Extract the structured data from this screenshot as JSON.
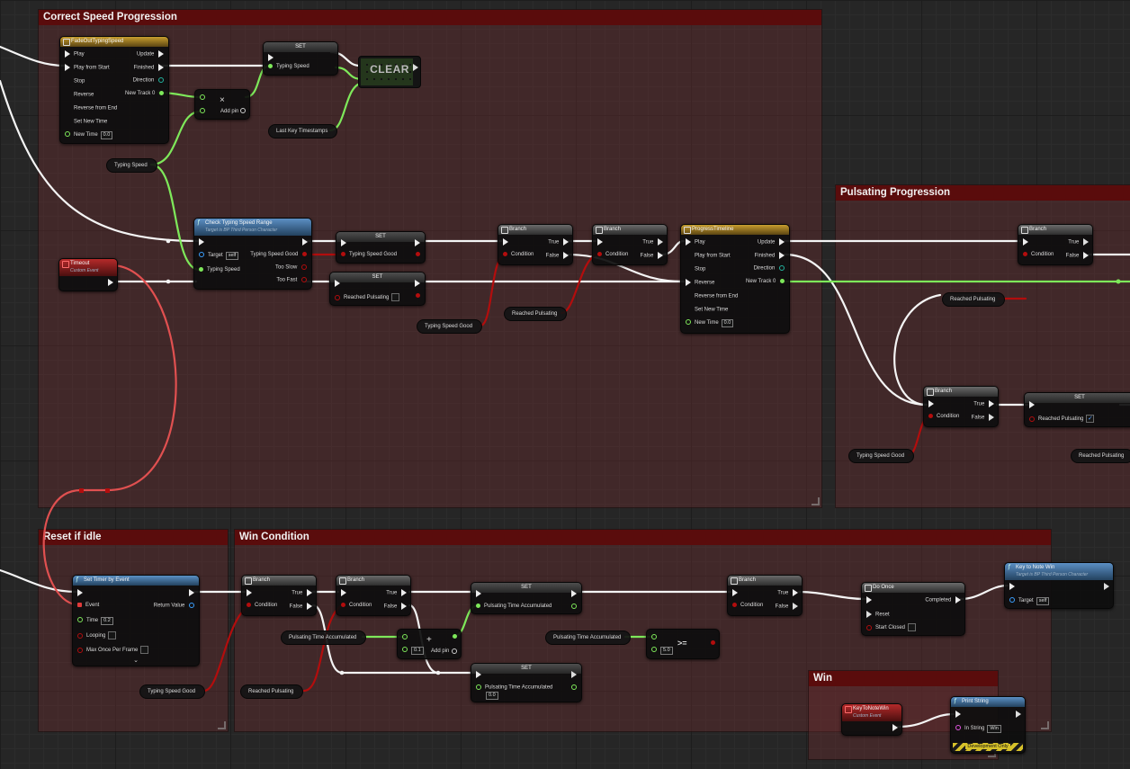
{
  "colors": {
    "comment_header": "#5a0c0c",
    "exec_wire": "#ffffff",
    "bool_wire": "#b30d0d",
    "float_wire": "#7ee85a",
    "event_wire": "#e05050"
  },
  "comments": {
    "correct_speed": "Correct Speed Progression",
    "pulsating": "Pulsating Progression",
    "reset_idle": "Reset if idle",
    "win_condition": "Win Condition",
    "win": "Win"
  },
  "timeline_fade": {
    "title": "FadeOutTypingSpeed",
    "in": [
      "Play",
      "Play from Start",
      "Stop",
      "Reverse",
      "Reverse from End",
      "Set New Time"
    ],
    "new_time_label": "New Time",
    "new_time_value": "0.0",
    "out": [
      "Update",
      "Finished",
      "Direction",
      "New Track 0"
    ]
  },
  "set_typing": {
    "title": "SET",
    "pin": "Typing Speed"
  },
  "clear": {
    "label": "CLEAR",
    "icon": "grid-array-icon"
  },
  "multiply": {
    "symbol": "×",
    "addpin": "Add pin"
  },
  "last_key": {
    "label": "Last Key Timestamps"
  },
  "typing_speed_var": {
    "label": "Typing Speed"
  },
  "timeout_event": {
    "title": "Timeout",
    "subtitle": "Custom Event"
  },
  "check_range": {
    "title": "Check Typing Speed Range",
    "subtitle": "Target is BP Third Person Character",
    "target": "Target",
    "target_value": "self",
    "typing_speed": "Typing Speed",
    "out": [
      "Typing Speed Good",
      "Too Slow",
      "Too Fast"
    ]
  },
  "set_tsg": {
    "title": "SET",
    "pin": "Typing Speed Good"
  },
  "set_rp_false": {
    "title": "SET",
    "pin": "Reached Pulsating"
  },
  "branch_labels": {
    "title": "Branch",
    "condition": "Condition",
    "true": "True",
    "false": "False"
  },
  "tsg_var": "Typing Speed Good",
  "rp_var": "Reached Pulsating",
  "progress_tl": {
    "title": "ProgressTimeline",
    "in": [
      "Play",
      "Play from Start",
      "Stop",
      "Reverse",
      "Reverse from End",
      "Set New Time"
    ],
    "new_time_label": "New Time",
    "new_time_value": "0.0",
    "out": [
      "Update",
      "Finished",
      "Direction",
      "New Track 0"
    ]
  },
  "set_rp_true": {
    "title": "SET",
    "pin": "Reached Pulsating",
    "checked": "✓"
  },
  "set_timer": {
    "title": "Set Timer by Event",
    "event": "Event",
    "return": "Return Value",
    "time_label": "Time",
    "time_value": "0.2",
    "looping": "Looping",
    "max_once": "Max Once Per Frame"
  },
  "pta_var": "Pulsating Time Accumulated",
  "add_node": {
    "symbol": "+",
    "addpin": "Add pin",
    "value": "0.1"
  },
  "set_pta": {
    "title": "SET",
    "pin": "Pulsating Time Accumulated"
  },
  "set_pta_reset": {
    "title": "SET",
    "pin": "Pulsating Time Accumulated",
    "value": "0.0"
  },
  "gte_node": {
    "symbol": ">=",
    "value": "5.0"
  },
  "do_once": {
    "title": "Do Once",
    "completed": "Completed",
    "reset": "Reset",
    "start_closed": "Start Closed"
  },
  "key_to_note": {
    "title": "Key to Note Win",
    "subtitle": "Target is BP Third Person Character",
    "target": "Target",
    "target_value": "self"
  },
  "key_event": {
    "title": "KeyToNoteWin",
    "subtitle": "Custom Event"
  },
  "print_string": {
    "title": "Print String",
    "in_string": "In String",
    "value": "Win",
    "dev_only": "Development Only"
  }
}
